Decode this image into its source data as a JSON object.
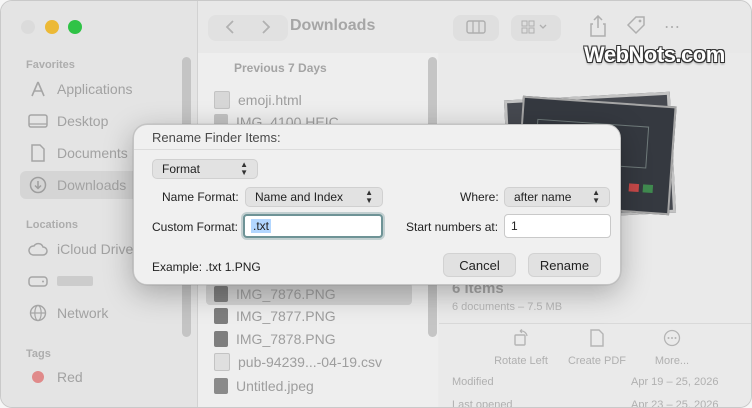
{
  "window": {
    "title": "Downloads"
  },
  "sidebar": {
    "sections": [
      {
        "label": "Favorites"
      },
      {
        "label": "Locations"
      },
      {
        "label": "Tags"
      }
    ],
    "favorites": [
      {
        "label": "Applications",
        "icon": "applications-icon"
      },
      {
        "label": "Desktop",
        "icon": "desktop-icon"
      },
      {
        "label": "Documents",
        "icon": "documents-icon"
      },
      {
        "label": "Downloads",
        "icon": "downloads-icon"
      }
    ],
    "locations": [
      {
        "label": "iCloud Drive",
        "icon": "cloud-icon"
      },
      {
        "label": "",
        "icon": "drive-icon"
      },
      {
        "label": "Network",
        "icon": "globe-icon"
      }
    ],
    "tags": [
      {
        "label": "Red",
        "color": "#e88a8a"
      }
    ]
  },
  "file_list": {
    "group_header": "Previous 7 Days",
    "files": [
      {
        "name": "emoji.html"
      },
      {
        "name": "IMG_4100.HEIC"
      },
      {
        "name": "IMG_7876.PNG"
      },
      {
        "name": "IMG_7877.PNG"
      },
      {
        "name": "IMG_7878.PNG"
      },
      {
        "name": "pub-94239...-04-19.csv"
      },
      {
        "name": "Untitled.jpeg"
      }
    ]
  },
  "preview": {
    "title": "6 items",
    "subtitle": "6 documents – 7.5 MB",
    "actions": [
      {
        "label": "Rotate Left",
        "icon": "rotate-left-icon"
      },
      {
        "label": "Create PDF",
        "icon": "pdf-icon"
      },
      {
        "label": "More...",
        "icon": "more-icon"
      }
    ],
    "meta": [
      {
        "label": "Modified",
        "value": "Apr 19 – 25, 2026"
      },
      {
        "label": "Last opened",
        "value": "Apr 23 – 25, 2026"
      }
    ]
  },
  "watermark": "WebNots.com",
  "dialog": {
    "title": "Rename Finder Items:",
    "mode_popup": "Format",
    "name_format_label": "Name Format:",
    "name_format_value": "Name and Index",
    "where_label": "Where:",
    "where_value": "after name",
    "custom_format_label": "Custom Format:",
    "custom_format_value": ".txt",
    "start_numbers_label": "Start numbers at:",
    "start_numbers_value": "1",
    "example": "Example: .txt 1.PNG",
    "cancel_label": "Cancel",
    "rename_label": "Rename"
  }
}
